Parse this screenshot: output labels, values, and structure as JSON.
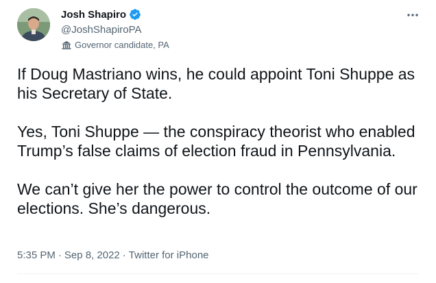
{
  "tweet": {
    "author": {
      "display_name": "Josh Shapiro",
      "handle": "@JoshShapiroPA",
      "verified": true,
      "label": "Governor candidate, PA",
      "label_icon": "government-building-icon"
    },
    "text_paragraphs": [
      "If Doug Mastriano wins, he could appoint Toni Shuppe as his Secretary of State.",
      "Yes, Toni Shuppe — the conspiracy theorist who enabled Trump’s false claims of election fraud in Pennsylvania.",
      "We can’t give her the power to control the outcome of our elections. She’s dangerous."
    ],
    "time": "5:35 PM",
    "date": "Sep 8, 2022",
    "separator": "·",
    "source": "Twitter for iPhone"
  },
  "colors": {
    "text_primary": "#0f1419",
    "text_secondary": "#536471",
    "verified_blue": "#1d9bf0",
    "divider": "#eff3f4"
  },
  "icons": {
    "verified": "verified-badge-icon",
    "more": "more-options-icon",
    "label": "government-building-icon"
  }
}
